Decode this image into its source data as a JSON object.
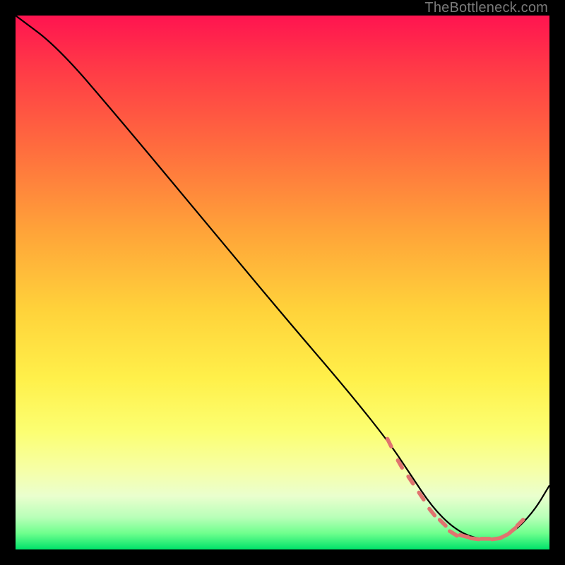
{
  "watermark": "TheBottleneck.com",
  "chart_data": {
    "type": "line",
    "title": "",
    "xlabel": "",
    "ylabel": "",
    "xlim": [
      0,
      100
    ],
    "ylim": [
      0,
      100
    ],
    "grid": false,
    "series": [
      {
        "name": "curve",
        "x": [
          0,
          8,
          20,
          35,
          50,
          62,
          70,
          74,
          78,
          82,
          86,
          90,
          93,
          97,
          100
        ],
        "y": [
          100,
          94,
          80,
          62,
          44,
          30,
          20,
          14,
          8,
          4,
          2,
          2,
          3,
          7,
          12
        ]
      }
    ],
    "markers": {
      "comment": "salmon dotted/ticked segment along the trough",
      "x": [
        70,
        72,
        74,
        76,
        78,
        80,
        82,
        84,
        86,
        88,
        90,
        91.5,
        93,
        94.5
      ],
      "y": [
        20,
        16,
        13,
        10,
        7,
        5,
        3,
        2.5,
        2,
        2,
        2,
        2.5,
        3.5,
        5
      ]
    },
    "colors": {
      "gradient_top": "#ff1450",
      "gradient_bottom": "#00e26a",
      "curve": "#000000",
      "markers": "#e0736f",
      "background": "#000000"
    }
  }
}
